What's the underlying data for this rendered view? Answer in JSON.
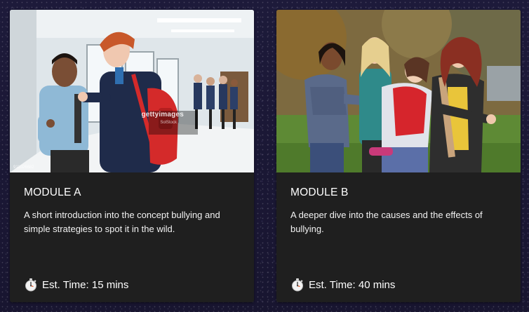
{
  "modules": [
    {
      "title": "MODULE A",
      "description": "A short introduction into the concept bullying and simple strategies to spot it in the wild.",
      "time_label": "Est. Time: 15 mins",
      "image_watermark": "gettyimages",
      "image_watermark_credit": "SolStock",
      "image_id": "911026682",
      "icon": "stopwatch-icon"
    },
    {
      "title": "MODULE B",
      "description": "A deeper dive into the causes and the effects of bullying.",
      "time_label": "Est. Time: 40 mins",
      "icon": "stopwatch-icon"
    }
  ],
  "colors": {
    "page_background": "#1a1734",
    "card_background": "#1f1f1f",
    "text": "#ffffff"
  }
}
